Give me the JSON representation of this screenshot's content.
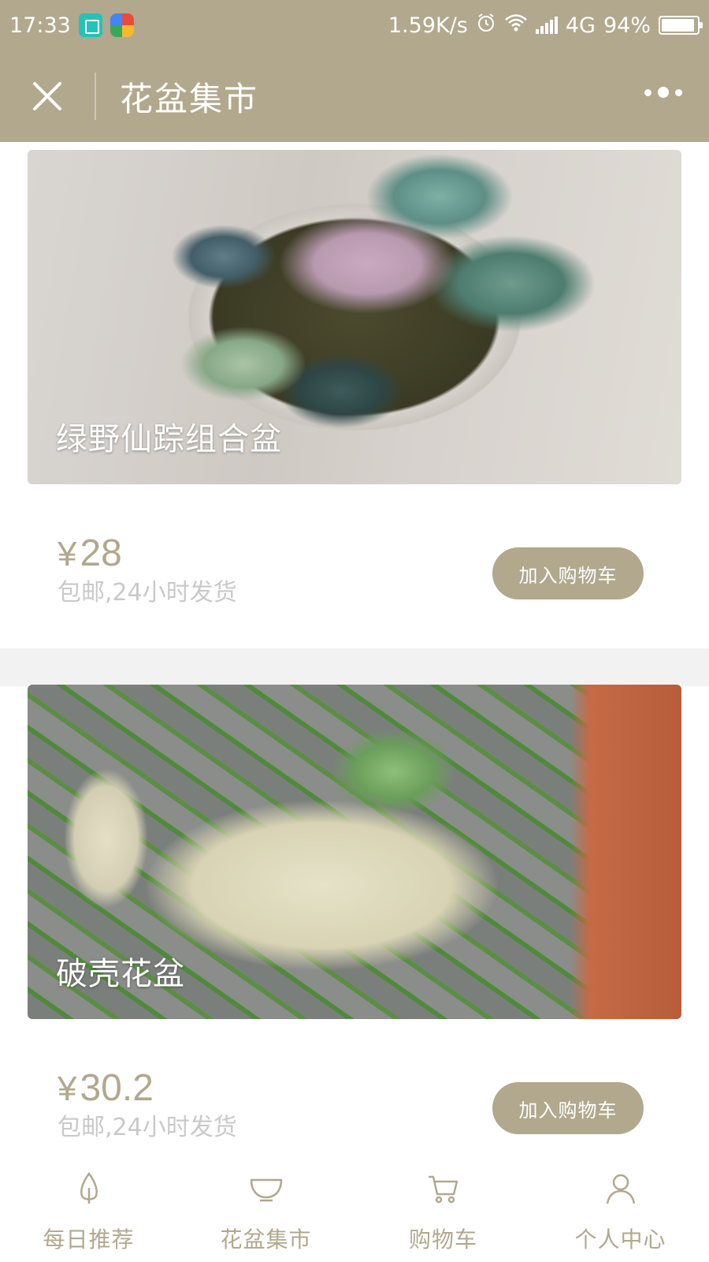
{
  "theme": {
    "accent": "#b1a88e",
    "separator": "#f2f2f2",
    "muted_text": "#c9c9c9"
  },
  "status_bar": {
    "time": "17:33",
    "speed": "1.59K/s",
    "network": "4G",
    "battery": "94%",
    "battery_level": 0.94,
    "icons": [
      "scan-app-icon",
      "colorful-app-icon",
      "alarm-icon",
      "wifi-icon",
      "signal-icon",
      "battery-icon"
    ]
  },
  "nav": {
    "title": "花盆集市",
    "close_icon": "close-icon",
    "more_icon": "more-icon"
  },
  "products": [
    {
      "name": "绿野仙踪组合盆",
      "currency": "¥",
      "price": "28",
      "desc": "包邮,24小时发货",
      "button": "加入购物车",
      "image": "succulent-bowl-image"
    },
    {
      "name": "破壳花盆",
      "currency": "¥",
      "price": "30.2",
      "desc": "包邮,24小时发货",
      "button": "加入购物车",
      "image": "broken-vase-planter-image"
    }
  ],
  "tabs": [
    {
      "label": "每日推荐",
      "icon": "leaf-icon"
    },
    {
      "label": "花盆集市",
      "icon": "bowl-icon"
    },
    {
      "label": "购物车",
      "icon": "cart-icon"
    },
    {
      "label": "个人中心",
      "icon": "user-icon"
    }
  ]
}
